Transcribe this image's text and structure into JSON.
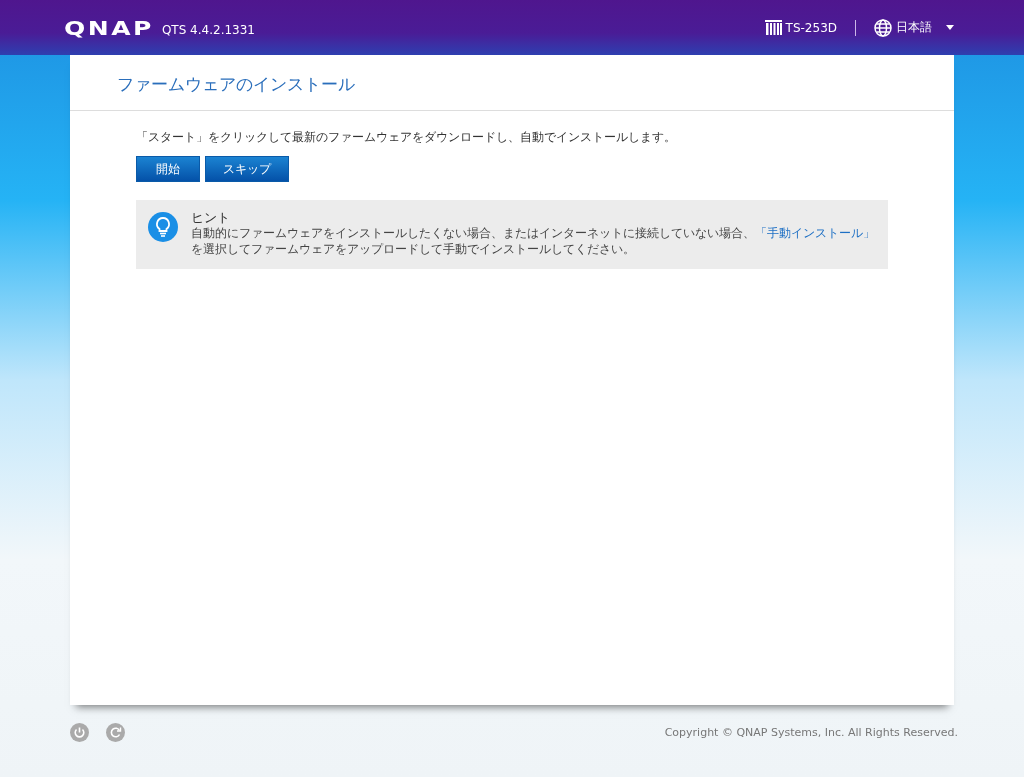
{
  "header": {
    "logo": "QNAP",
    "version": "QTS 4.4.2.1331",
    "device": "TS-253D",
    "language": "日本語"
  },
  "page": {
    "title": "ファームウェアのインストール",
    "instruction": "「スタート」をクリックして最新のファームウェアをダウンロードし、自動でインストールします。",
    "buttons": [
      "開始",
      "スキップ"
    ],
    "hint": {
      "title": "ヒント",
      "text_before": "自動的にファームウェアをインストールしたくない場合、またはインターネットに接続していない場合、",
      "link": "「手動インストール」",
      "text_after": "を選択してファームウェアをアップロードして手動でインストールしてください。"
    }
  },
  "footer": {
    "copyright": "Copyright © QNAP Systems, Inc. All Rights Reserved."
  }
}
